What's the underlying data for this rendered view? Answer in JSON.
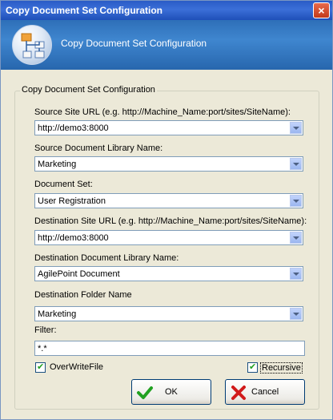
{
  "window": {
    "title": "Copy Document Set Configuration",
    "close_glyph": "×"
  },
  "banner": {
    "title": "Copy Document Set Configuration",
    "icon": "workflow-icon"
  },
  "group": {
    "title": "Copy Document Set Configuration"
  },
  "fields": {
    "source_site_url": {
      "label": "Source Site URL (e.g. http://Machine_Name:port/sites/SiteName):",
      "value": "http://demo3:8000"
    },
    "source_library": {
      "label": "Source Document Library Name:",
      "value": "Marketing"
    },
    "document_set": {
      "label": "Document Set:",
      "value": "User Registration"
    },
    "destination_site_url": {
      "label": "Destination Site URL (e.g. http://Machine_Name:port/sites/SiteName):",
      "value": "http://demo3:8000"
    },
    "destination_library": {
      "label": "Destination Document Library Name:",
      "value": "AgilePoint Document"
    },
    "destination_folder": {
      "label": "Destination Folder Name",
      "value": "Marketing"
    },
    "filter": {
      "label": "Filter:",
      "value": "*.*"
    }
  },
  "checkboxes": {
    "overwrite": {
      "label": "OverWriteFile",
      "checked": true
    },
    "recursive": {
      "label": "Recursive",
      "checked": true
    }
  },
  "buttons": {
    "ok": "OK",
    "cancel": "Cancel"
  },
  "colors": {
    "titlebar": "#2a5bc6",
    "banner": "#3f86cf",
    "check_green": "#21a121",
    "cancel_red": "#d11a1a"
  }
}
